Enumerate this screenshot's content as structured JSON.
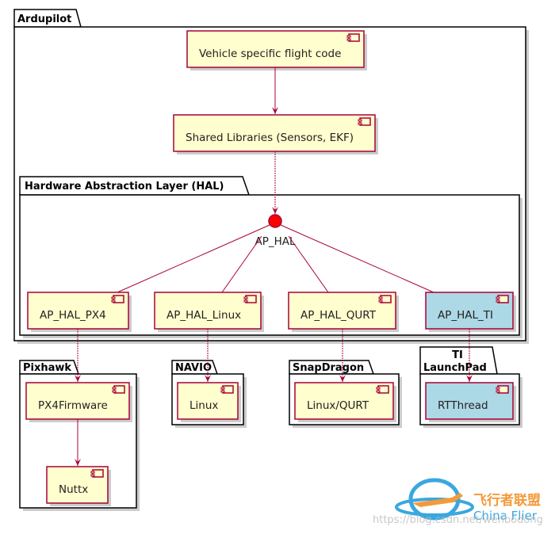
{
  "colors": {
    "component_fill": "#FEFECE",
    "component_border": "#A80036",
    "highlight_fill": "#ADD8E6",
    "interface_fill": "#FF0000"
  },
  "packages": {
    "ardupilot": "Ardupilot",
    "hal": "Hardware Abstraction Layer (HAL)",
    "pixhawk": "Pixhawk",
    "navio": "NAVIO",
    "snapdragon": "SnapDragon",
    "ti_line1": "TI",
    "ti_line2": "LaunchPad"
  },
  "components": {
    "vehicle": "Vehicle specific flight code",
    "shared": "Shared Libraries (Sensors, EKF)",
    "ap_hal": "AP_HAL",
    "px4": "AP_HAL_PX4",
    "linux": "AP_HAL_Linux",
    "qurt": "AP_HAL_QURT",
    "ti": "AP_HAL_TI",
    "px4firmware": "PX4Firmware",
    "nuttx": "Nuttx",
    "navio_linux": "Linux",
    "linux_qurt": "Linux/QURT",
    "rtthread": "RTThread"
  },
  "watermark": {
    "url": "https://blog.csdn.net/wenbodong",
    "brand_cn": "飞行者联盟",
    "brand_en": "China Flier"
  }
}
